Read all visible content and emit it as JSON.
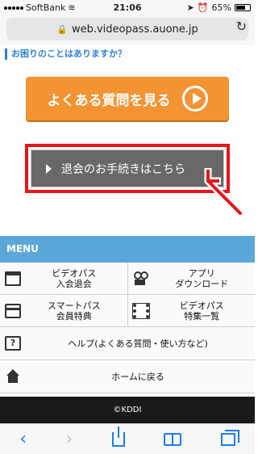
{
  "status_bar": {
    "carrier": "SoftBank",
    "time": "21:06",
    "battery": "65%"
  },
  "browser": {
    "url": "web.videopass.auone.jp"
  },
  "content": {
    "question_heading": "お困りのことはありますか？",
    "faq_button_label": "よくある質問を見る",
    "cancel_button_label": "退会のお手続きはこちら"
  },
  "menu": {
    "title": "MENU",
    "items": [
      {
        "label_line1": "ビデオパス",
        "label_line2": "入会退会",
        "icon": "clapperboard-icon"
      },
      {
        "label_line1": "アプリ",
        "label_line2": "ダウンロード",
        "icon": "video-camera-icon"
      },
      {
        "label_line1": "スマートパス",
        "label_line2": "会員特典",
        "icon": "card-icon"
      },
      {
        "label_line1": "ビデオパス",
        "label_line2": "特集一覧",
        "icon": "film-icon"
      }
    ],
    "help_label": "ヘルプ(よくある質問・使い方など)",
    "home_label": "ホームに戻る"
  },
  "footer": {
    "copyright": "©KDDI"
  },
  "colors": {
    "orange": "#f39332",
    "red_border": "#e8141b",
    "menu_blue": "#5ba7d9",
    "link_blue": "#2f7fd6",
    "safari_blue": "#1d7cf2"
  }
}
